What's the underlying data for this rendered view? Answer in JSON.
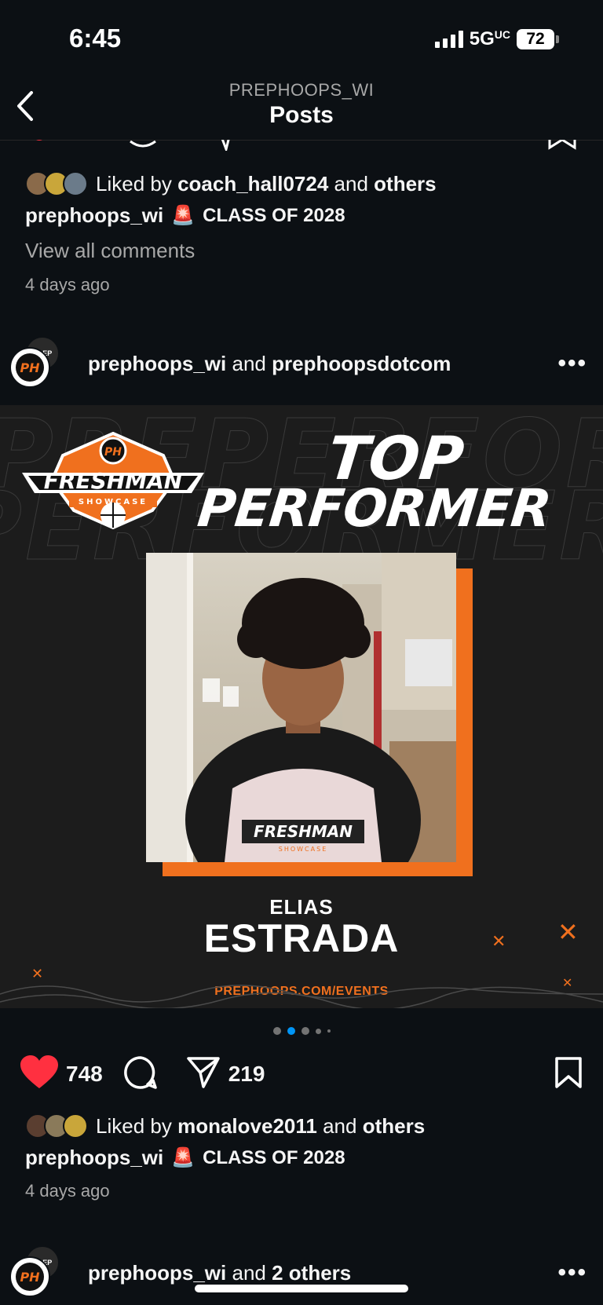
{
  "status_bar": {
    "time": "6:45",
    "network": "5G",
    "network_suffix": "UC",
    "battery": "72"
  },
  "header": {
    "account": "PREPHOOPS_WI",
    "title": "Posts"
  },
  "prev_post": {
    "liked_by_prefix": "Liked by",
    "liked_by_user": "coach_hall0724",
    "and_text": "and",
    "others": "others",
    "caption_user": "prephoops_wi",
    "caption_text": "CLASS OF 2028",
    "view_comments": "View all comments",
    "time_ago": "4 days ago"
  },
  "post": {
    "user1": "prephoops_wi",
    "and_text": "and",
    "user2": "prephoopsdotcom",
    "image": {
      "logo_word": "FRESHMAN",
      "logo_sub": "SHOWCASE",
      "headline_1": "TOP",
      "headline_2": "PERFORMER",
      "jersey_word": "FRESHMAN",
      "jersey_sub": "SHOWCASE",
      "first_name": "ELIAS",
      "last_name": "ESTRADA",
      "url": "PREPHOOPS.COM/EVENTS"
    },
    "carousel": {
      "count": 5,
      "active_index": 1
    },
    "likes": "748",
    "shares": "219",
    "liked_by_prefix": "Liked by",
    "liked_by_user": "monalove2011",
    "others": "others",
    "caption_user": "prephoops_wi",
    "caption_text": "CLASS OF 2028",
    "time_ago": "4 days ago"
  },
  "next_post": {
    "user1": "prephoops_wi",
    "and_text": "and",
    "others_text": "2 others"
  },
  "colors": {
    "accent_orange": "#f0701e",
    "like_red": "#ff3040",
    "bg": "#0c1014",
    "dot_active": "#0095f6"
  },
  "icons": [
    "back-arrow-icon",
    "heart-icon",
    "comment-icon",
    "share-icon",
    "bookmark-icon",
    "more-icon",
    "siren-icon"
  ]
}
